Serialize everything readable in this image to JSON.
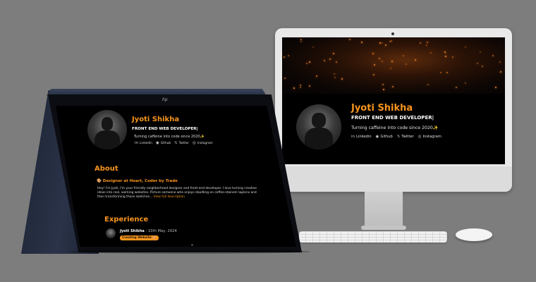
{
  "desktop": {
    "name": "Jyoti Shikha",
    "role": "FRONT END WEB DEVELOPER|",
    "tagline": "Turning caffeine into code since 2020✨",
    "socials": [
      {
        "icon": "linkedin-icon",
        "glyph": "in",
        "label": "Linkedin"
      },
      {
        "icon": "github-icon",
        "glyph": "◉",
        "label": "Github"
      },
      {
        "icon": "twitter-icon",
        "glyph": "𝕏",
        "label": "Twitter"
      },
      {
        "icon": "instagram-icon",
        "glyph": "◎",
        "label": "Instagram"
      }
    ]
  },
  "laptop": {
    "logo": "hp",
    "name": "Jyoti Shikha",
    "role": "FRONT END WEB DEVELOPER|",
    "tagline": "Turning caffeine into code since 2020✨",
    "socials": [
      {
        "icon": "linkedin-icon",
        "glyph": "in",
        "label": "Linkedin"
      },
      {
        "icon": "github-icon",
        "glyph": "◉",
        "label": "Github"
      },
      {
        "icon": "twitter-icon",
        "glyph": "𝕏",
        "label": "Twitter"
      },
      {
        "icon": "instagram-icon",
        "glyph": "◎",
        "label": "Instagram"
      }
    ],
    "about_heading": "About",
    "about_subheading": "🎨 Designer at Heart, Coder by Trade",
    "bio": "Hey! I'm Jyoti, I'm your friendly neighborhood designer and front-end developer. I love turning creative ideas into real, working websites. Picture someone who enjoys doodling on coffee-stained napkins and then transforming those sketches...",
    "bio_link": "View full description",
    "experience_heading": "Experience",
    "experience_item": {
      "title": "Jyoti Shikha",
      "date": " - 10th May, 2024",
      "badge": "Creating Website 🎨"
    }
  },
  "colors": {
    "accent": "#f7941d",
    "background": "#7d7d7d",
    "screen": "#000000"
  }
}
